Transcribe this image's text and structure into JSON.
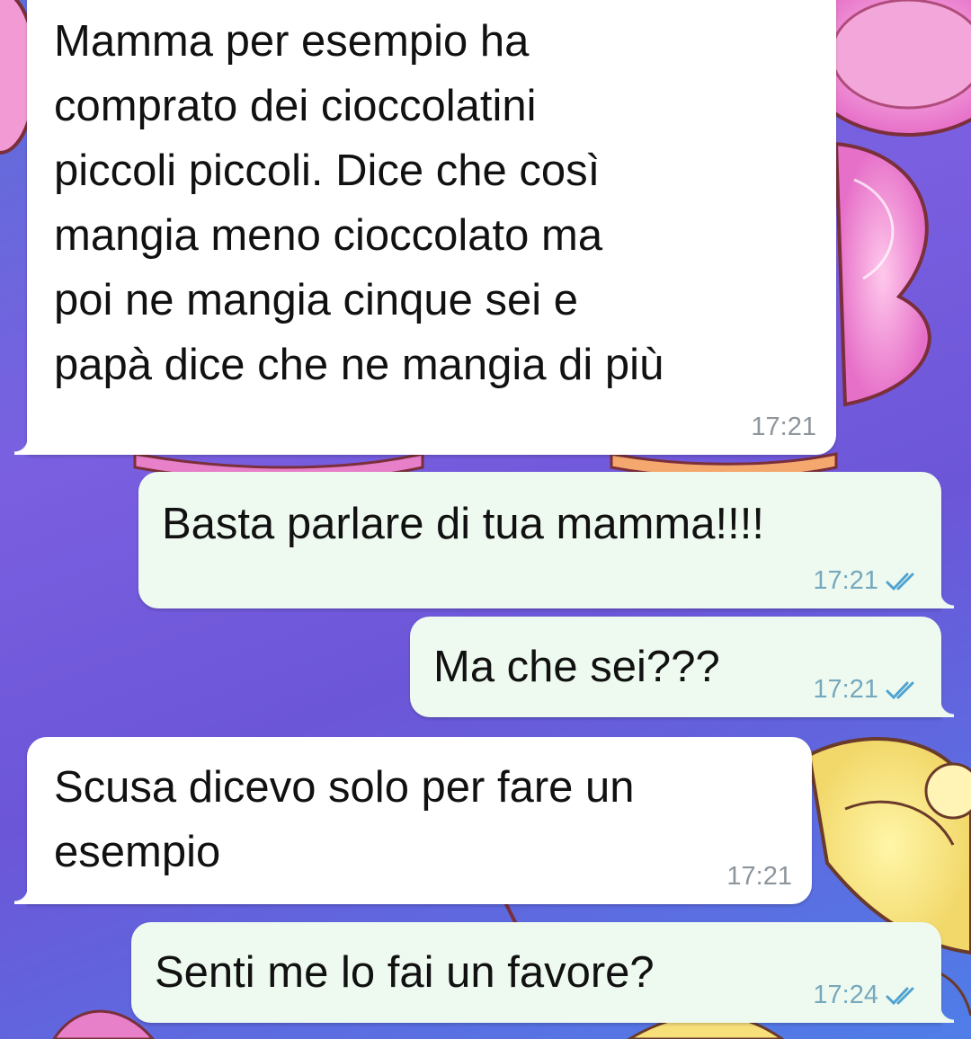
{
  "chat": {
    "messages": [
      {
        "direction": "incoming",
        "text": "Mamma per esempio ha\ncomprato dei cioccolatini\npiccoli piccoli. Dice che così\nmangia meno cioccolato ma\npoi ne mangia cinque sei e\npapà dice che ne mangia di più",
        "time": "17:21"
      },
      {
        "direction": "outgoing",
        "text": "Basta parlare di tua mamma!!!!",
        "time": "17:21",
        "status": "read"
      },
      {
        "direction": "outgoing",
        "text": "Ma che sei???",
        "time": "17:21",
        "status": "read"
      },
      {
        "direction": "incoming",
        "text": "Scusa dicevo solo per fare un\nesempio",
        "time": "17:21"
      },
      {
        "direction": "outgoing",
        "text": "Senti me lo fai un favore?",
        "time": "17:24",
        "status": "read"
      }
    ]
  },
  "colors": {
    "incoming_bubble": "#ffffff",
    "outgoing_bubble": "#eefaf0",
    "read_ticks": "#4fa3d1"
  },
  "icons": {
    "read_status": "double-check-icon"
  }
}
